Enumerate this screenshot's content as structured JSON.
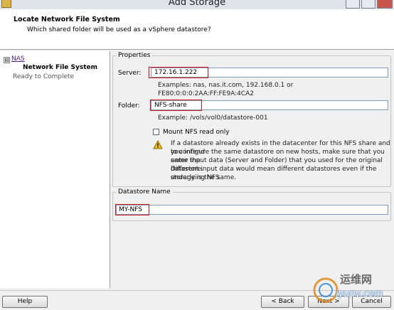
{
  "window": {
    "title": "Add Storage"
  },
  "header": {
    "title": "Locate Network File System",
    "subtitle": "Which shared folder will be used as a vSphere datastore?"
  },
  "nav": {
    "toggle": "⊟",
    "items": [
      {
        "label": "NAS",
        "style": "link"
      },
      {
        "label": "Network File System",
        "style": "current"
      },
      {
        "label": "Ready to Complete",
        "style": "pending"
      }
    ]
  },
  "properties": {
    "group_label": "Properties",
    "server_label": "Server:",
    "server_value": "172.16.1.222",
    "server_hint_1": "Examples: nas, nas.it.com, 192.168.0.1 or",
    "server_hint_2": "FE80:0:0:0:2AA:FF:FE9A:4CA2",
    "folder_label": "Folder:",
    "folder_value": "NFS-share",
    "folder_hint": "Example: /vols/vol0/datastore-001",
    "mount_readonly_label": "Mount NFS read only",
    "mount_readonly_checked": false,
    "warning_text_1": "If a datastore already exists in the datacenter for this NFS share and you intend",
    "warning_text_2": "to configure the same datastore on new hosts, make sure that you enter the",
    "warning_text_3": "same input data (Server and Folder) that you used for the original datastore.",
    "warning_text_4": "Different input data would mean different datastores even if the underlying NFS",
    "warning_text_5": "storage is the same."
  },
  "datastore": {
    "group_label": "Datastore Name",
    "name_value": "MY-NFS"
  },
  "footer": {
    "help_label": "Help",
    "back_label": "< Back",
    "next_label": "Next >",
    "cancel_label": "Cancel"
  },
  "watermark": {
    "cn": "运维网",
    "url": "iyunv.com"
  },
  "colors": {
    "highlight": "#d01818",
    "link": "#551a8b"
  }
}
